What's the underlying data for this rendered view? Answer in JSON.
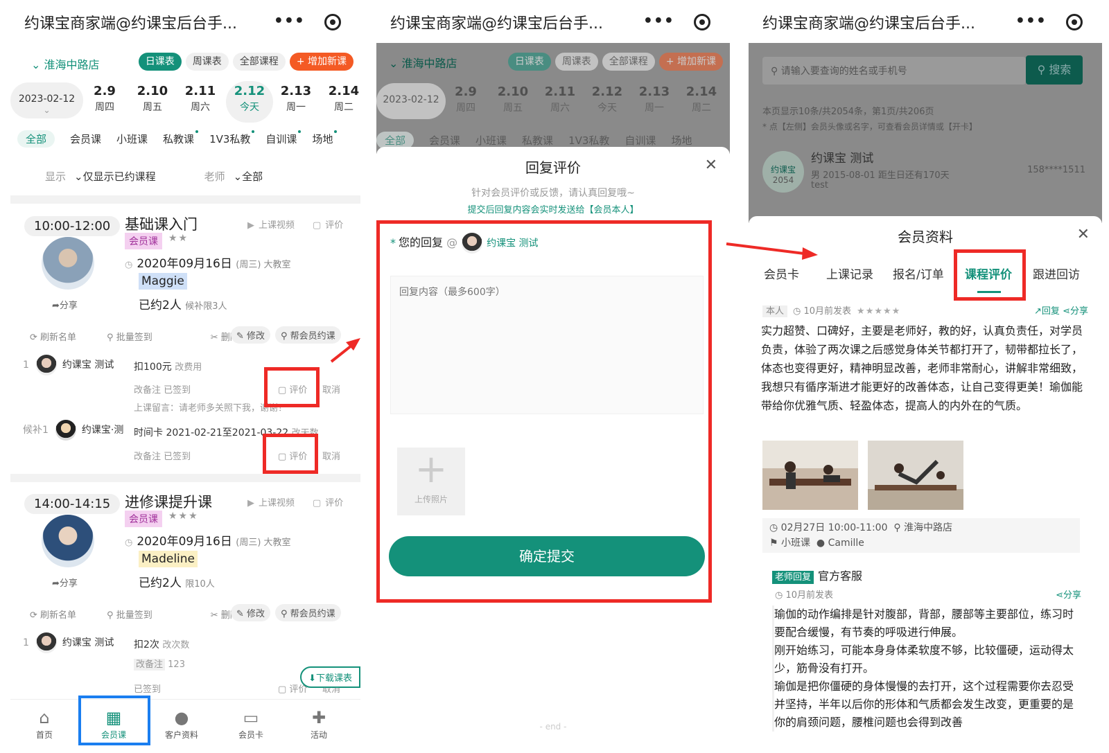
{
  "app_title": "约课宝商家端@约课宝后台手...",
  "capsule": {
    "more": "•••"
  },
  "panel1": {
    "store": "⌄ 淮海中路店",
    "pills": [
      "日课表",
      "周课表",
      "全部课程",
      "+ 增加新课"
    ],
    "date_select": "2023-02-12",
    "date_select_caret": "⌄",
    "dates": [
      {
        "d": "2.9",
        "w": "周四"
      },
      {
        "d": "2.10",
        "w": "周五"
      },
      {
        "d": "2.11",
        "w": "周六"
      },
      {
        "d": "2.12",
        "w": "今天"
      },
      {
        "d": "2.13",
        "w": "周一"
      },
      {
        "d": "2.14",
        "w": "周二"
      }
    ],
    "categories": [
      "全部",
      "会员课",
      "小班课",
      "私教课",
      "1V3私教",
      "自训课",
      "场地"
    ],
    "filter": {
      "show_label": "显示",
      "show_value": "⌄仅显示已约课程",
      "teacher_label": "老师",
      "teacher_value": "⌄全部"
    },
    "classes": [
      {
        "time": "10:00-12:00",
        "title": "基础课入门",
        "video": "上课视频",
        "eval": "评价",
        "tag": "会员课",
        "stars": "★★",
        "date": "2020年09月16日",
        "date_note": "(周三) 大教室",
        "teacher": "Maggie",
        "booked": "已约2人",
        "booked_note": "候补限3人",
        "share": "分享",
        "actions": [
          "刷新名单",
          "批量签到",
          "删除"
        ],
        "btn_edit": "修改",
        "btn_book": "帮会员约课",
        "members": [
          {
            "num": "1",
            "name": "约课宝 测试",
            "plan": "扣100元",
            "plan_note": "改费用",
            "sub": "改备注  已签到",
            "eval": "评价",
            "cancel": "取消",
            "msg": "上课留言：请老师多关照下我，谢谢！"
          },
          {
            "num": "候补1",
            "name": "约课宝·测",
            "plan": "时间卡 2021-02-21至2021-03-22",
            "plan_note": "改天数",
            "sub": "改备注  已签到",
            "eval": "评价",
            "cancel": "取消"
          }
        ]
      },
      {
        "time": "14:00-14:15",
        "title": "进修课提升课",
        "video": "上课视频",
        "eval": "评价",
        "tag": "会员课",
        "stars": "★★★",
        "date": "2020年09月16日",
        "date_note": "(周三) 大教室",
        "teacher": "Madeline",
        "booked": "已约2人",
        "booked_note": "限10人",
        "share": "分享",
        "actions": [
          "刷新名单",
          "批量签到",
          "删除"
        ],
        "btn_edit": "修改",
        "btn_book": "帮会员约课",
        "members": [
          {
            "num": "1",
            "name": "约课宝 测试",
            "plan": "扣2次",
            "plan_note": "改次数",
            "sub": "改备注",
            "sub_val": "123",
            "sub2": "已签到",
            "eval": "评价",
            "cancel": "取消"
          }
        ]
      }
    ],
    "download": "下载课表",
    "tabs": [
      {
        "label": "首页",
        "icon": "⌂"
      },
      {
        "label": "会员课",
        "icon": "▦"
      },
      {
        "label": "客户资料",
        "icon": "●"
      },
      {
        "label": "会员卡",
        "icon": "▭"
      },
      {
        "label": "活动",
        "icon": "✚"
      }
    ]
  },
  "panel2": {
    "sheet_title": "回复评价",
    "close": "✕",
    "hint1": "针对会员评价或反馈，请认真回复哦~",
    "hint2": "提交后回复内容会实时发送给【会员本人】",
    "reply_label": "您的回复",
    "reply_at": "@",
    "reply_to": "约课宝 测试",
    "placeholder": "回复内容（最多600字）",
    "upload_label": "上传照片",
    "submit": "确定提交",
    "end": "- end -"
  },
  "panel3": {
    "search_placeholder": "请输入要查询的姓名或手机号",
    "search_btn": "搜索",
    "page_info": "本页显示10条/共2054条，第1页/共206页",
    "page_tip": "* 点【左侧】会员头像或名字，可查看会员详情或【开卡】",
    "member_name": "约课宝 测试",
    "member_logo": "约课宝",
    "member_id": "2054",
    "member_detail": "男 2015-08-01 距生日还有170天",
    "member_note": "test",
    "member_phone": "158****1511",
    "sheet_title": "会员资料",
    "close": "✕",
    "tabs": [
      "会员卡",
      "上课记录",
      "报名/订单",
      "课程评价",
      "跟进回访"
    ],
    "review": {
      "self": "本人",
      "time": "10月前发表",
      "stars": "★★★★★",
      "reply": "回复",
      "share": "分享",
      "text": "实力超赞、口碑好，主要是老师好，教的好，认真负责任，对学员负责，体验了两次课之后感觉身体关节都打开了，韧带都拉长了，体态也变得更好，精神明显改善，老师非常耐心，讲解非常细致，我想只有循序渐进才能更好的改善体态，让自己变得更美！瑜伽能带给你优雅气质、轻盈体态，提高人的内外在的气质。",
      "class_time": "02月27日 10:00-11:00",
      "class_store": "淮海中路店",
      "class_type": "小班课",
      "class_teacher": "Camille"
    },
    "teacher_reply": {
      "badge": "老师回复",
      "name": "官方客服",
      "time": "10月前发表",
      "share": "分享",
      "text": "瑜伽的动作编排是针对腹部，背部，腰部等主要部位，练习时要配合缓慢，有节奏的呼吸进行伸展。\n刚开始练习，可能本身身体柔软度不够，比较僵硬，运动得太少，筋骨没有打开。\n瑜伽是把你僵硬的身体慢慢的去打开，这个过程需要你去忍受并坚持，半年以后你的形体和气质都会发生改变，更重要的是你的肩颈问题，腰椎问题也会得到改善"
    }
  },
  "colors": {
    "primary": "#14917a",
    "accent": "#f45a24",
    "highlight": "#ee2a26"
  }
}
